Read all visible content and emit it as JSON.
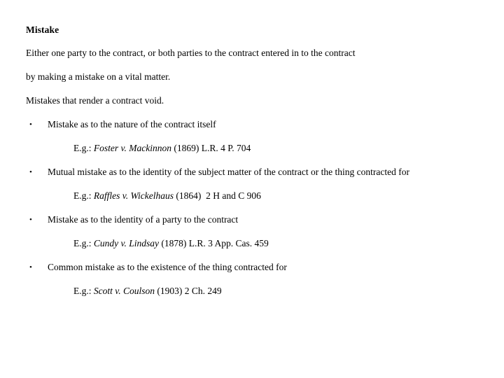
{
  "document": {
    "heading": "Mistake",
    "paragraphs": [
      "Either one party to the contract, or both parties to the contract entered in to the contract by making a mistake on a vital matter.",
      "Mistakes that render a contract void."
    ],
    "paragraph_lines": [
      "Either one party to the contract, or both parties to the contract entered in to the contract",
      "by making a mistake on a vital matter.",
      "Mistakes that render a contract void."
    ],
    "bullet_glyph": "•",
    "eg_label": "E.g.: ",
    "items": [
      {
        "text": "Mistake as to the nature of the contract itself",
        "example": {
          "label": "E.g.: ",
          "case_name": "Foster v. Mackinnon",
          "citation": " (1869) L.R. 4 P. 704"
        }
      },
      {
        "text": "Mutual mistake as to the identity of the subject matter of the contract or the thing contracted for",
        "example": {
          "label": "E.g.: ",
          "case_name": "Raffles v. Wickelhaus",
          "citation": " (1864)  2 H and C 906"
        }
      },
      {
        "text": "Mistake as to the identity of a party to the contract",
        "example": {
          "label": "E.g.: ",
          "case_name": "Cundy v. Lindsay",
          "citation": " (1878) L.R. 3 App. Cas. 459"
        }
      },
      {
        "text": "Common mistake as to the existence of the thing contracted for",
        "example": {
          "label": "E.g.: ",
          "case_name": "Scott v. Coulson",
          "citation": " (1903) 2 Ch. 249"
        }
      }
    ]
  },
  "colors": {
    "background": "#ffffff",
    "text": "#000000"
  }
}
